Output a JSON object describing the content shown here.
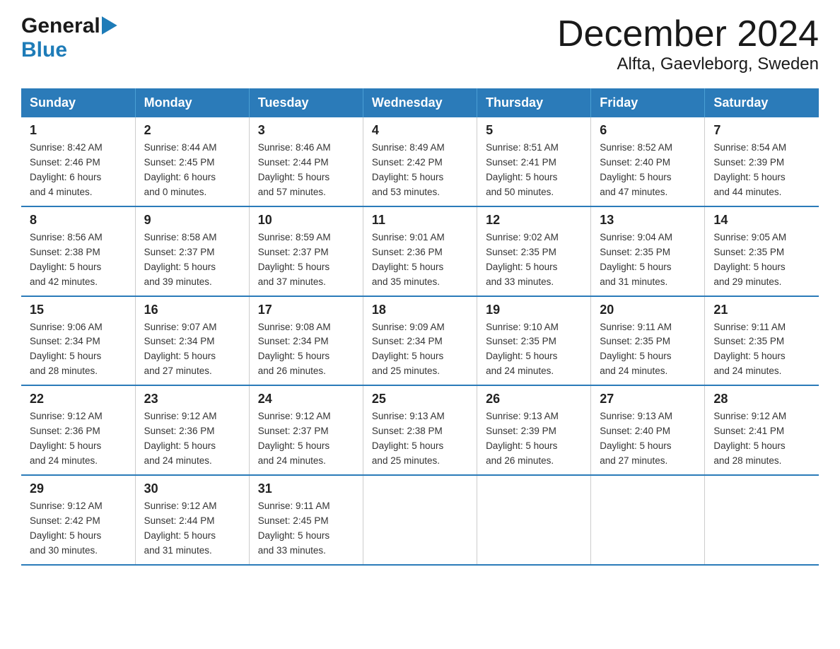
{
  "logo": {
    "general": "General",
    "blue": "Blue"
  },
  "title": "December 2024",
  "subtitle": "Alfta, Gaevleborg, Sweden",
  "days_header": [
    "Sunday",
    "Monday",
    "Tuesday",
    "Wednesday",
    "Thursday",
    "Friday",
    "Saturday"
  ],
  "weeks": [
    [
      {
        "num": "1",
        "info": "Sunrise: 8:42 AM\nSunset: 2:46 PM\nDaylight: 6 hours\nand 4 minutes."
      },
      {
        "num": "2",
        "info": "Sunrise: 8:44 AM\nSunset: 2:45 PM\nDaylight: 6 hours\nand 0 minutes."
      },
      {
        "num": "3",
        "info": "Sunrise: 8:46 AM\nSunset: 2:44 PM\nDaylight: 5 hours\nand 57 minutes."
      },
      {
        "num": "4",
        "info": "Sunrise: 8:49 AM\nSunset: 2:42 PM\nDaylight: 5 hours\nand 53 minutes."
      },
      {
        "num": "5",
        "info": "Sunrise: 8:51 AM\nSunset: 2:41 PM\nDaylight: 5 hours\nand 50 minutes."
      },
      {
        "num": "6",
        "info": "Sunrise: 8:52 AM\nSunset: 2:40 PM\nDaylight: 5 hours\nand 47 minutes."
      },
      {
        "num": "7",
        "info": "Sunrise: 8:54 AM\nSunset: 2:39 PM\nDaylight: 5 hours\nand 44 minutes."
      }
    ],
    [
      {
        "num": "8",
        "info": "Sunrise: 8:56 AM\nSunset: 2:38 PM\nDaylight: 5 hours\nand 42 minutes."
      },
      {
        "num": "9",
        "info": "Sunrise: 8:58 AM\nSunset: 2:37 PM\nDaylight: 5 hours\nand 39 minutes."
      },
      {
        "num": "10",
        "info": "Sunrise: 8:59 AM\nSunset: 2:37 PM\nDaylight: 5 hours\nand 37 minutes."
      },
      {
        "num": "11",
        "info": "Sunrise: 9:01 AM\nSunset: 2:36 PM\nDaylight: 5 hours\nand 35 minutes."
      },
      {
        "num": "12",
        "info": "Sunrise: 9:02 AM\nSunset: 2:35 PM\nDaylight: 5 hours\nand 33 minutes."
      },
      {
        "num": "13",
        "info": "Sunrise: 9:04 AM\nSunset: 2:35 PM\nDaylight: 5 hours\nand 31 minutes."
      },
      {
        "num": "14",
        "info": "Sunrise: 9:05 AM\nSunset: 2:35 PM\nDaylight: 5 hours\nand 29 minutes."
      }
    ],
    [
      {
        "num": "15",
        "info": "Sunrise: 9:06 AM\nSunset: 2:34 PM\nDaylight: 5 hours\nand 28 minutes."
      },
      {
        "num": "16",
        "info": "Sunrise: 9:07 AM\nSunset: 2:34 PM\nDaylight: 5 hours\nand 27 minutes."
      },
      {
        "num": "17",
        "info": "Sunrise: 9:08 AM\nSunset: 2:34 PM\nDaylight: 5 hours\nand 26 minutes."
      },
      {
        "num": "18",
        "info": "Sunrise: 9:09 AM\nSunset: 2:34 PM\nDaylight: 5 hours\nand 25 minutes."
      },
      {
        "num": "19",
        "info": "Sunrise: 9:10 AM\nSunset: 2:35 PM\nDaylight: 5 hours\nand 24 minutes."
      },
      {
        "num": "20",
        "info": "Sunrise: 9:11 AM\nSunset: 2:35 PM\nDaylight: 5 hours\nand 24 minutes."
      },
      {
        "num": "21",
        "info": "Sunrise: 9:11 AM\nSunset: 2:35 PM\nDaylight: 5 hours\nand 24 minutes."
      }
    ],
    [
      {
        "num": "22",
        "info": "Sunrise: 9:12 AM\nSunset: 2:36 PM\nDaylight: 5 hours\nand 24 minutes."
      },
      {
        "num": "23",
        "info": "Sunrise: 9:12 AM\nSunset: 2:36 PM\nDaylight: 5 hours\nand 24 minutes."
      },
      {
        "num": "24",
        "info": "Sunrise: 9:12 AM\nSunset: 2:37 PM\nDaylight: 5 hours\nand 24 minutes."
      },
      {
        "num": "25",
        "info": "Sunrise: 9:13 AM\nSunset: 2:38 PM\nDaylight: 5 hours\nand 25 minutes."
      },
      {
        "num": "26",
        "info": "Sunrise: 9:13 AM\nSunset: 2:39 PM\nDaylight: 5 hours\nand 26 minutes."
      },
      {
        "num": "27",
        "info": "Sunrise: 9:13 AM\nSunset: 2:40 PM\nDaylight: 5 hours\nand 27 minutes."
      },
      {
        "num": "28",
        "info": "Sunrise: 9:12 AM\nSunset: 2:41 PM\nDaylight: 5 hours\nand 28 minutes."
      }
    ],
    [
      {
        "num": "29",
        "info": "Sunrise: 9:12 AM\nSunset: 2:42 PM\nDaylight: 5 hours\nand 30 minutes."
      },
      {
        "num": "30",
        "info": "Sunrise: 9:12 AM\nSunset: 2:44 PM\nDaylight: 5 hours\nand 31 minutes."
      },
      {
        "num": "31",
        "info": "Sunrise: 9:11 AM\nSunset: 2:45 PM\nDaylight: 5 hours\nand 33 minutes."
      },
      {
        "num": "",
        "info": ""
      },
      {
        "num": "",
        "info": ""
      },
      {
        "num": "",
        "info": ""
      },
      {
        "num": "",
        "info": ""
      }
    ]
  ]
}
